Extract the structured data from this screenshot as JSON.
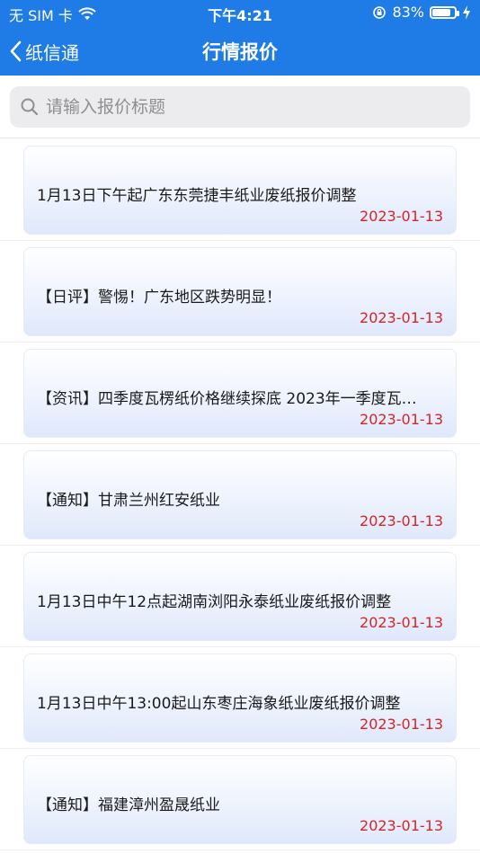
{
  "status_bar": {
    "carrier": "无 SIM 卡",
    "time": "下午4:21",
    "battery": "83%",
    "battery_level": 0.83
  },
  "nav": {
    "back_label": "纸信通",
    "title": "行情报价"
  },
  "search": {
    "placeholder": "请输入报价标题"
  },
  "items": [
    {
      "title": "1月13日下午起广东东莞捷丰纸业废纸报价调整",
      "date": "2023-01-13"
    },
    {
      "title": "【日评】警惕！广东地区跌势明显！",
      "date": "2023-01-13"
    },
    {
      "title": "【资讯】四季度瓦楞纸价格继续探底 2023年一季度瓦…",
      "date": "2023-01-13"
    },
    {
      "title": "【通知】甘肃兰州红安纸业",
      "date": "2023-01-13"
    },
    {
      "title": "1月13日中午12点起湖南浏阳永泰纸业废纸报价调整",
      "date": "2023-01-13"
    },
    {
      "title": "1月13日中午13:00起山东枣庄海象纸业废纸报价调整",
      "date": "2023-01-13"
    },
    {
      "title": "【通知】福建漳州盈晟纸业",
      "date": "2023-01-13"
    }
  ],
  "colors": {
    "header_bg": "#1f7be6",
    "date_red": "#d32626"
  }
}
